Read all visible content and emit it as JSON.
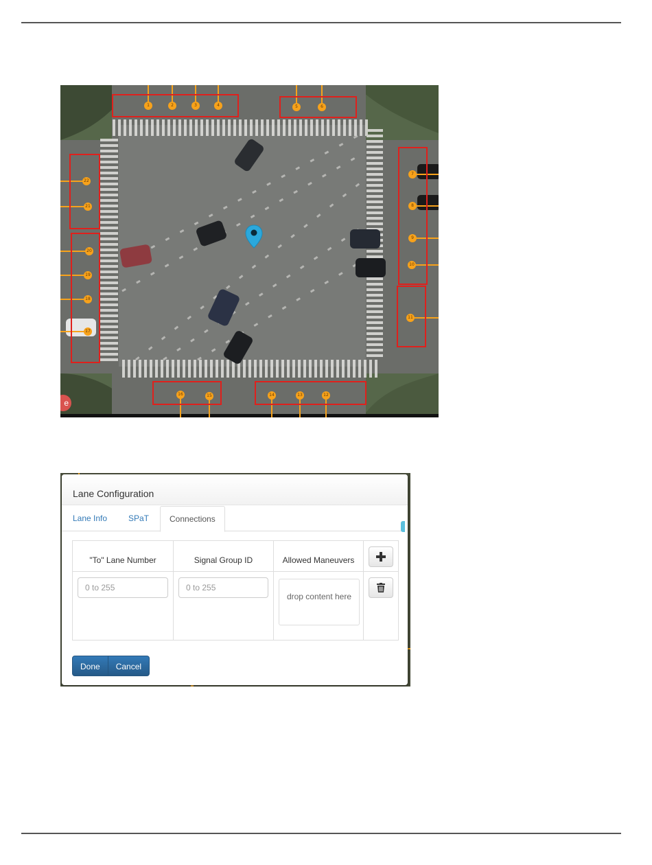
{
  "map": {
    "lane_labels": [
      "1",
      "2",
      "3",
      "4",
      "5",
      "6",
      "7",
      "8",
      "9",
      "10",
      "11",
      "12",
      "13",
      "14",
      "15",
      "16",
      "17",
      "18",
      "19",
      "20",
      "21",
      "22"
    ],
    "badge_text": "e",
    "marker": "map-pin-icon"
  },
  "dialog": {
    "title": "Lane Configuration",
    "tabs": [
      {
        "label": "Lane Info",
        "active": false
      },
      {
        "label": "SPaT",
        "active": false
      },
      {
        "label": "Connections",
        "active": true
      }
    ],
    "columns": [
      "\"To\" Lane Number",
      "Signal Group ID",
      "Allowed Maneuvers"
    ],
    "row": {
      "to_lane_placeholder": "0 to 255",
      "signal_group_placeholder": "0 to 255",
      "maneuvers_drop_text": "drop content here"
    },
    "add_icon": "plus-icon",
    "delete_icon": "trash-icon",
    "buttons": {
      "done": "Done",
      "cancel": "Cancel"
    }
  },
  "colors": {
    "accent": "#337ab7",
    "lane_marker": "#f7a21b",
    "box": "#e0201c"
  }
}
